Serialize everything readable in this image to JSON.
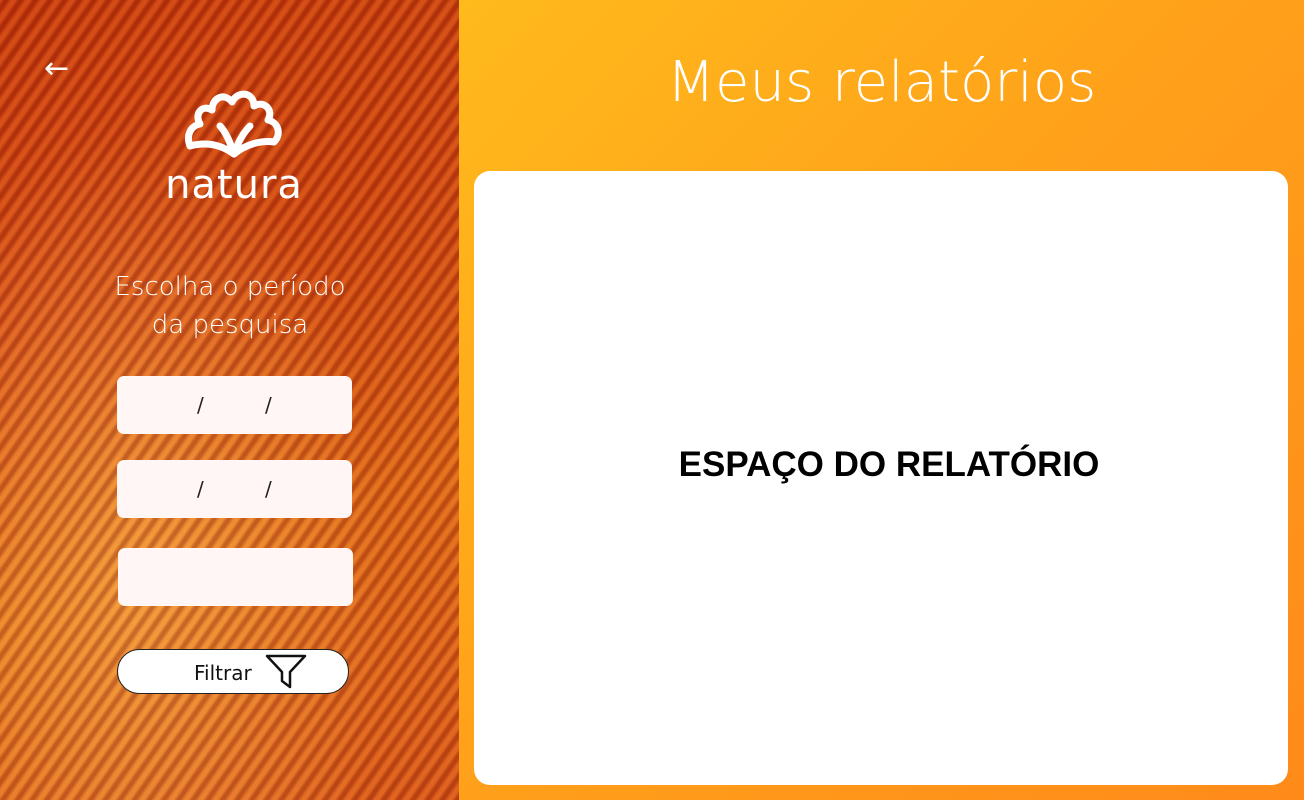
{
  "sidebar": {
    "back_arrow": "←",
    "brand": "natura",
    "period_title_line1": "Escolha o período",
    "period_title_line2": "da pesquisa",
    "start_date": {
      "slash1": "/",
      "slash2": "/"
    },
    "end_date": {
      "slash1": "/",
      "slash2": "/"
    },
    "filter_label": "Filtrar"
  },
  "main": {
    "title": "Meus relatórios",
    "report_placeholder": "ESPAÇO DO RELATÓRIO"
  },
  "colors": {
    "accent_orange": "#ffa21a",
    "deep_orange": "#d9501a",
    "field_bg": "#fff6f5"
  },
  "icons": [
    "back-arrow-icon",
    "natura-logo",
    "filter-icon"
  ]
}
